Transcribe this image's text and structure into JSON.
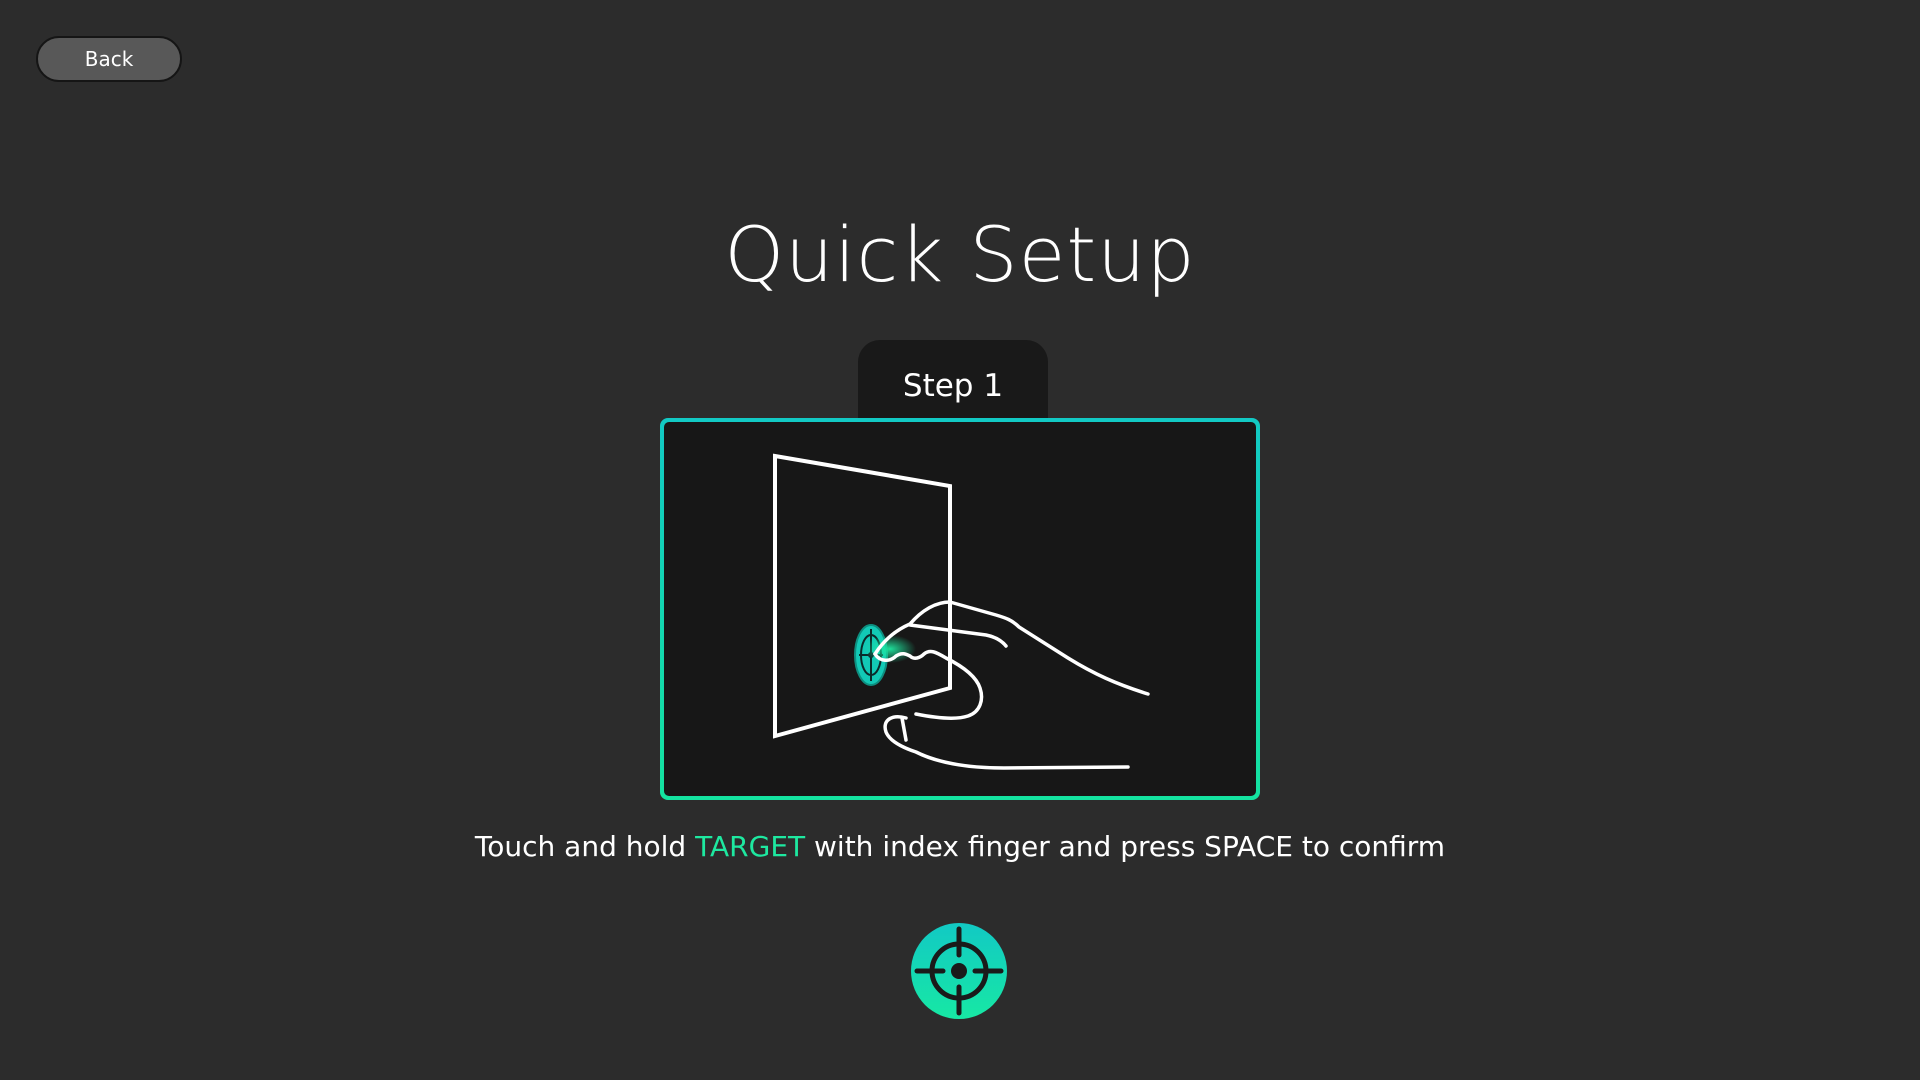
{
  "nav": {
    "back_label": "Back"
  },
  "title": "Quick Setup",
  "step": {
    "label": "Step 1"
  },
  "instruction": {
    "before": "Touch and hold ",
    "highlight": "TARGET",
    "after": " with index finger and press SPACE to confirm"
  },
  "icons": {
    "illustration": "hand-touching-screen-illustration",
    "target": "crosshair-target-icon"
  },
  "colors": {
    "background": "#2c2c2c",
    "panel": "#171717",
    "accent_teal": "#12c9c4",
    "accent_green": "#1ee8a0",
    "button_gray": "#585858"
  }
}
